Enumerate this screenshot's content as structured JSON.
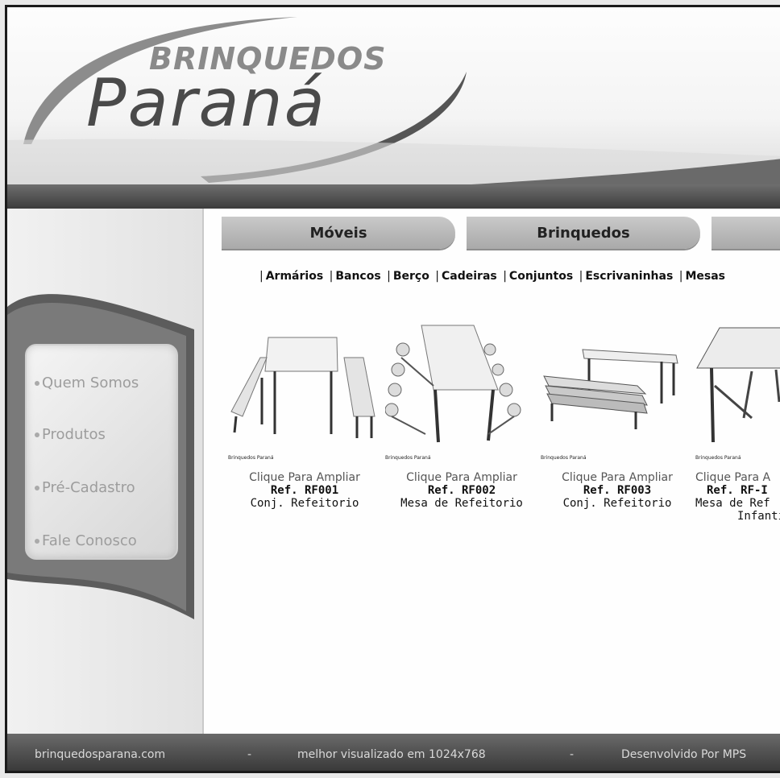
{
  "header": {
    "logo_top": "BRINQUEDOS",
    "logo_main": "Paraná"
  },
  "sidebar": {
    "items": [
      {
        "label": "Quem Somos"
      },
      {
        "label": "Produtos"
      },
      {
        "label": "Pré-Cadastro"
      },
      {
        "label": "Fale Conosco"
      }
    ]
  },
  "tabs": [
    {
      "label": "Móveis"
    },
    {
      "label": "Brinquedos"
    },
    {
      "label": ""
    }
  ],
  "categories": [
    "Armários",
    "Bancos",
    "Berço",
    "Cadeiras",
    "Conjuntos",
    "Escrivaninhas",
    "Mesas"
  ],
  "products": [
    {
      "brand": "Brinquedos Paraná",
      "click": "Clique Para Ampliar",
      "ref": "Ref. RF001",
      "name": "Conj. Refeitorio",
      "name2": ""
    },
    {
      "brand": "Brinquedos Paraná",
      "click": "Clique Para Ampliar",
      "ref": "Ref. RF002",
      "name": "Mesa de Refeitorio",
      "name2": ""
    },
    {
      "brand": "Brinquedos Paraná",
      "click": "Clique Para Ampliar",
      "ref": "Ref. RF003",
      "name": "Conj. Refeitorio",
      "name2": ""
    },
    {
      "brand": "Brinquedos Paraná",
      "click": "Clique Para A",
      "ref": "Ref. RF-I",
      "name": "Mesa de Ref",
      "name2": "Infanti"
    }
  ],
  "footer": {
    "site": "brinquedosparana.com",
    "sep1": "-",
    "resolution": "melhor visualizado em 1024x768",
    "sep2": "-",
    "dev": "Desenvolvido Por MPS"
  },
  "colors": {
    "header_bar": "#4a4a4a",
    "tab": "#b8b8b8",
    "menu_text": "#9d9d9d"
  }
}
